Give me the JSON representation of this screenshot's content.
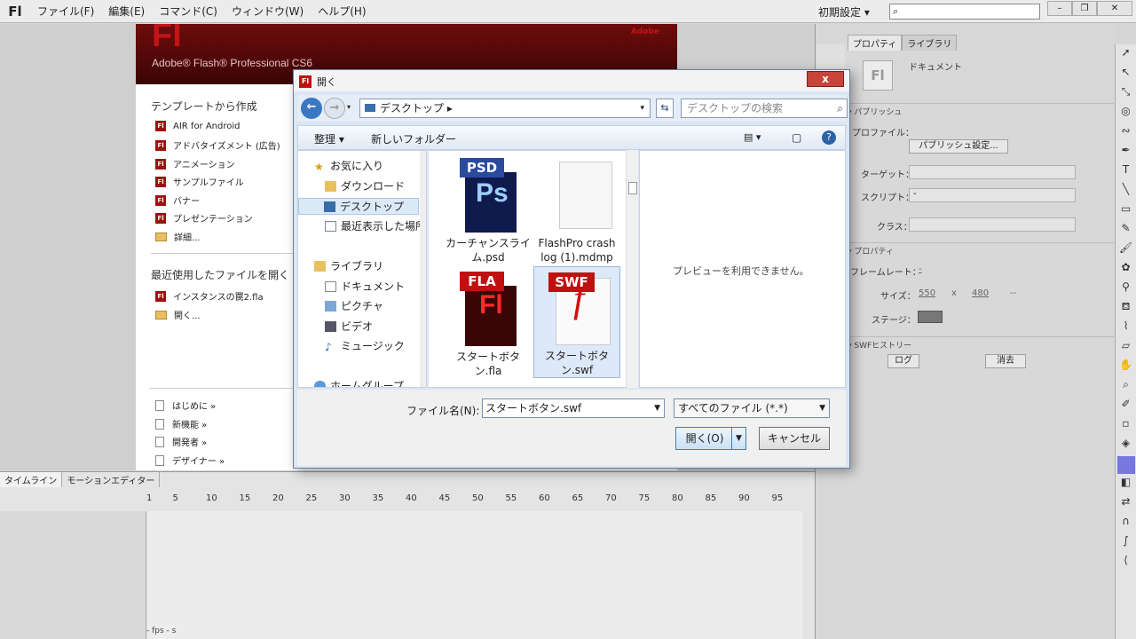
{
  "menubar": {
    "logo": "Fl",
    "menus": [
      "ファイル(F)",
      "編集(E)",
      "コマンド(C)",
      "ウィンドウ(W)",
      "ヘルプ(H)"
    ],
    "workspace": "初期設定",
    "search_placeholder": ""
  },
  "welcome": {
    "banner_logo": "Fl",
    "banner_product": "Adobe® Flash® Professional CS6",
    "banner_brand": "Adobe",
    "templates_heading": "テンプレートから作成",
    "templates": [
      "AIR for Android",
      "アドバタイズメント (広告)",
      "アニメーション",
      "サンプルファイル",
      "バナー",
      "プレゼンテーション",
      "詳細..."
    ],
    "recent_heading": "最近使用したファイルを開く",
    "recent": [
      "インスタンスの罠2.fla",
      "開く..."
    ],
    "links": [
      "はじめに »",
      "新機能 »",
      "開発者 »",
      "デザイナー »"
    ]
  },
  "timeline": {
    "tabs": [
      "タイムライン",
      "モーションエディター"
    ],
    "frame_numbers": [
      "1",
      "5",
      "10",
      "15",
      "20",
      "25",
      "30",
      "35",
      "40",
      "45",
      "50",
      "55",
      "60",
      "65",
      "70",
      "75",
      "80",
      "85",
      "90",
      "95"
    ],
    "bottom_status": "- fps   - s"
  },
  "properties": {
    "tabs": [
      "プロパティ",
      "ライブラリ"
    ],
    "doc_icon": "Fl",
    "doc_type": "ドキュメント",
    "publish_section": "パブリッシュ",
    "profile_label": "プロファイル：",
    "publish_settings_button": "パブリッシュ設定...",
    "target_label": "ターゲット：",
    "script_label": "スクリプト：",
    "script_value": "-",
    "class_label": "クラス：",
    "props_section": "プロパティ",
    "fps_label": "フレームレート：",
    "fps_value": "-",
    "size_label": "サイズ：",
    "size_w": "550",
    "size_x": "x",
    "size_h": "480",
    "size_unit": "--",
    "stage_label": "ステージ：",
    "stage_color": "#777777",
    "swf_history_section": "SWFヒストリー",
    "log_button": "ログ",
    "clear_button": "消去"
  },
  "dialog": {
    "title_icon": "Fl",
    "title": "開く",
    "close_label": "x",
    "address": "デスクトップ",
    "search_placeholder": "デスクトップの検索",
    "organize": "整理 ▾",
    "new_folder": "新しいフォルダー",
    "nav": [
      {
        "label": "お気に入り",
        "icon": "star-icon",
        "selected": false
      },
      {
        "label": "ダウンロード",
        "icon": "download-icon",
        "selected": false
      },
      {
        "label": "デスクトップ",
        "icon": "desktop-icon",
        "selected": true
      },
      {
        "label": "最近表示した場所",
        "icon": "recent-icon",
        "selected": false
      },
      {
        "label": "ライブラリ",
        "icon": "library-icon",
        "selected": false
      },
      {
        "label": "ドキュメント",
        "icon": "documents-icon",
        "selected": false
      },
      {
        "label": "ピクチャ",
        "icon": "pictures-icon",
        "selected": false
      },
      {
        "label": "ビデオ",
        "icon": "videos-icon",
        "selected": false
      },
      {
        "label": "ミュージック",
        "icon": "music-icon",
        "selected": false
      },
      {
        "label": "ホームグループ",
        "icon": "homegroup-icon",
        "selected": false
      }
    ],
    "files": [
      {
        "name": "カーチャンスライム.psd",
        "type": "PSD",
        "badge": "Ps",
        "selected": false
      },
      {
        "name": "FlashPro crash log (1).mdmp",
        "type": "",
        "badge": "",
        "selected": false
      },
      {
        "name": "スタートボタン.fla",
        "type": "FLA",
        "badge": "Fl",
        "selected": false
      },
      {
        "name": "スタートボタン.swf",
        "type": "SWF",
        "badge": "f",
        "selected": true
      }
    ],
    "preview_text": "プレビューを利用できません。",
    "filename_label": "ファイル名(N):",
    "filename_value": "スタートボタン.swf",
    "filetype_value": "すべてのファイル (*.*)",
    "open_button": "開く(O)",
    "cancel_button": "キャンセル"
  }
}
